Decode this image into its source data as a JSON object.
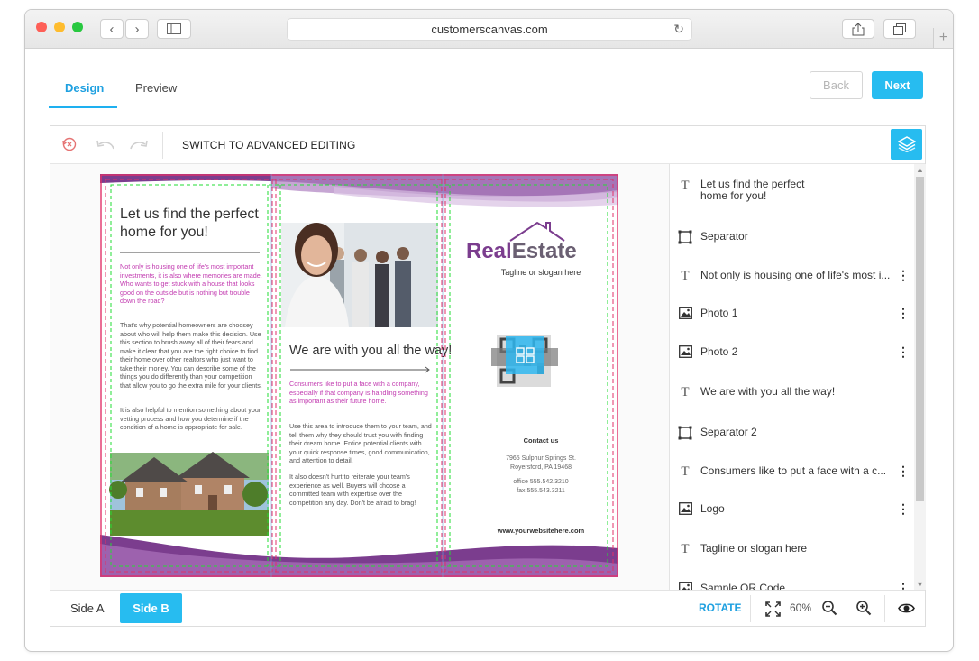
{
  "browser": {
    "url": "customerscanvas.com",
    "reload_icon": "reload-icon",
    "plus": "+"
  },
  "tabs": [
    {
      "label": "Design",
      "active": true
    },
    {
      "label": "Preview",
      "active": false
    }
  ],
  "actions": {
    "back": "Back",
    "next": "Next"
  },
  "toolbar": {
    "advanced_label": "SWITCH TO ADVANCED EDITING"
  },
  "brochure": {
    "left_heading_1": "Let us find the perfect",
    "left_heading_2": "home for you!",
    "left_pink": "Not only is housing one of life's most important investments, it is also where memories are made. Who wants to get stuck with a house that looks good on the outside but is nothing but trouble down the road?",
    "left_body_1": "That's why potential homeowners are choosey about who will help them make this decision. Use this section to brush away all of their fears and make it clear that you are the right choice to find their home over other realtors who just want to take their money. You can describe some of the things you do differently than your competition that allow you to go the extra mile for your clients.",
    "left_body_2": "It is also helpful to mention something about your vetting process and how you determine if the condition of a home is appropriate for sale.",
    "mid_heading": "We are with you all the way!",
    "mid_pink": "Consumers like to put a face with a company, especially if that company is handling something as important as their future home.",
    "mid_body_1": "Use this area to introduce them to your team, and tell them why they should trust you with finding their dream home. Entice potential clients with your quick response times, good communication, and attention to detail.",
    "mid_body_2": "It also doesn't hurt to reiterate your team's experience as well. Buyers will choose a committed team with expertise over the competition any day. Don't be afraid to brag!",
    "logo_real": "Real",
    "logo_estate": "Estate",
    "tagline": "Tagline or slogan here",
    "contact_title": "Contact us",
    "address_1": "7965 Sulphur Springs St.",
    "address_2": "Royersford, PA 19468",
    "office": "office 555.542.3210",
    "fax": "fax 555.543.3211",
    "website": "www.yourwebsitehere.com"
  },
  "layers": [
    {
      "type": "text",
      "label": "Let us find the perfect\nhome for you!",
      "menu": false
    },
    {
      "type": "shape",
      "label": "Separator",
      "menu": false
    },
    {
      "type": "text",
      "label": "Not only is housing one of life's most i...",
      "menu": true
    },
    {
      "type": "image",
      "label": "Photo 1",
      "menu": true
    },
    {
      "type": "image",
      "label": "Photo 2",
      "menu": true
    },
    {
      "type": "text",
      "label": "We are with you all the way!",
      "menu": false
    },
    {
      "type": "shape",
      "label": "Separator 2",
      "menu": false
    },
    {
      "type": "text",
      "label": "Consumers like to put a face with a c...",
      "menu": true
    },
    {
      "type": "image",
      "label": "Logo",
      "menu": true
    },
    {
      "type": "text",
      "label": "Tagline or slogan here",
      "menu": false
    },
    {
      "type": "image",
      "label": "Sample QR Code",
      "menu": true
    }
  ],
  "bottom": {
    "side_a": "Side A",
    "side_b": "Side B",
    "rotate": "ROTATE",
    "zoom": "60%"
  },
  "colors": {
    "accent": "#27bcf0",
    "purple": "#7a3d8c",
    "magenta": "#c23bb0"
  }
}
